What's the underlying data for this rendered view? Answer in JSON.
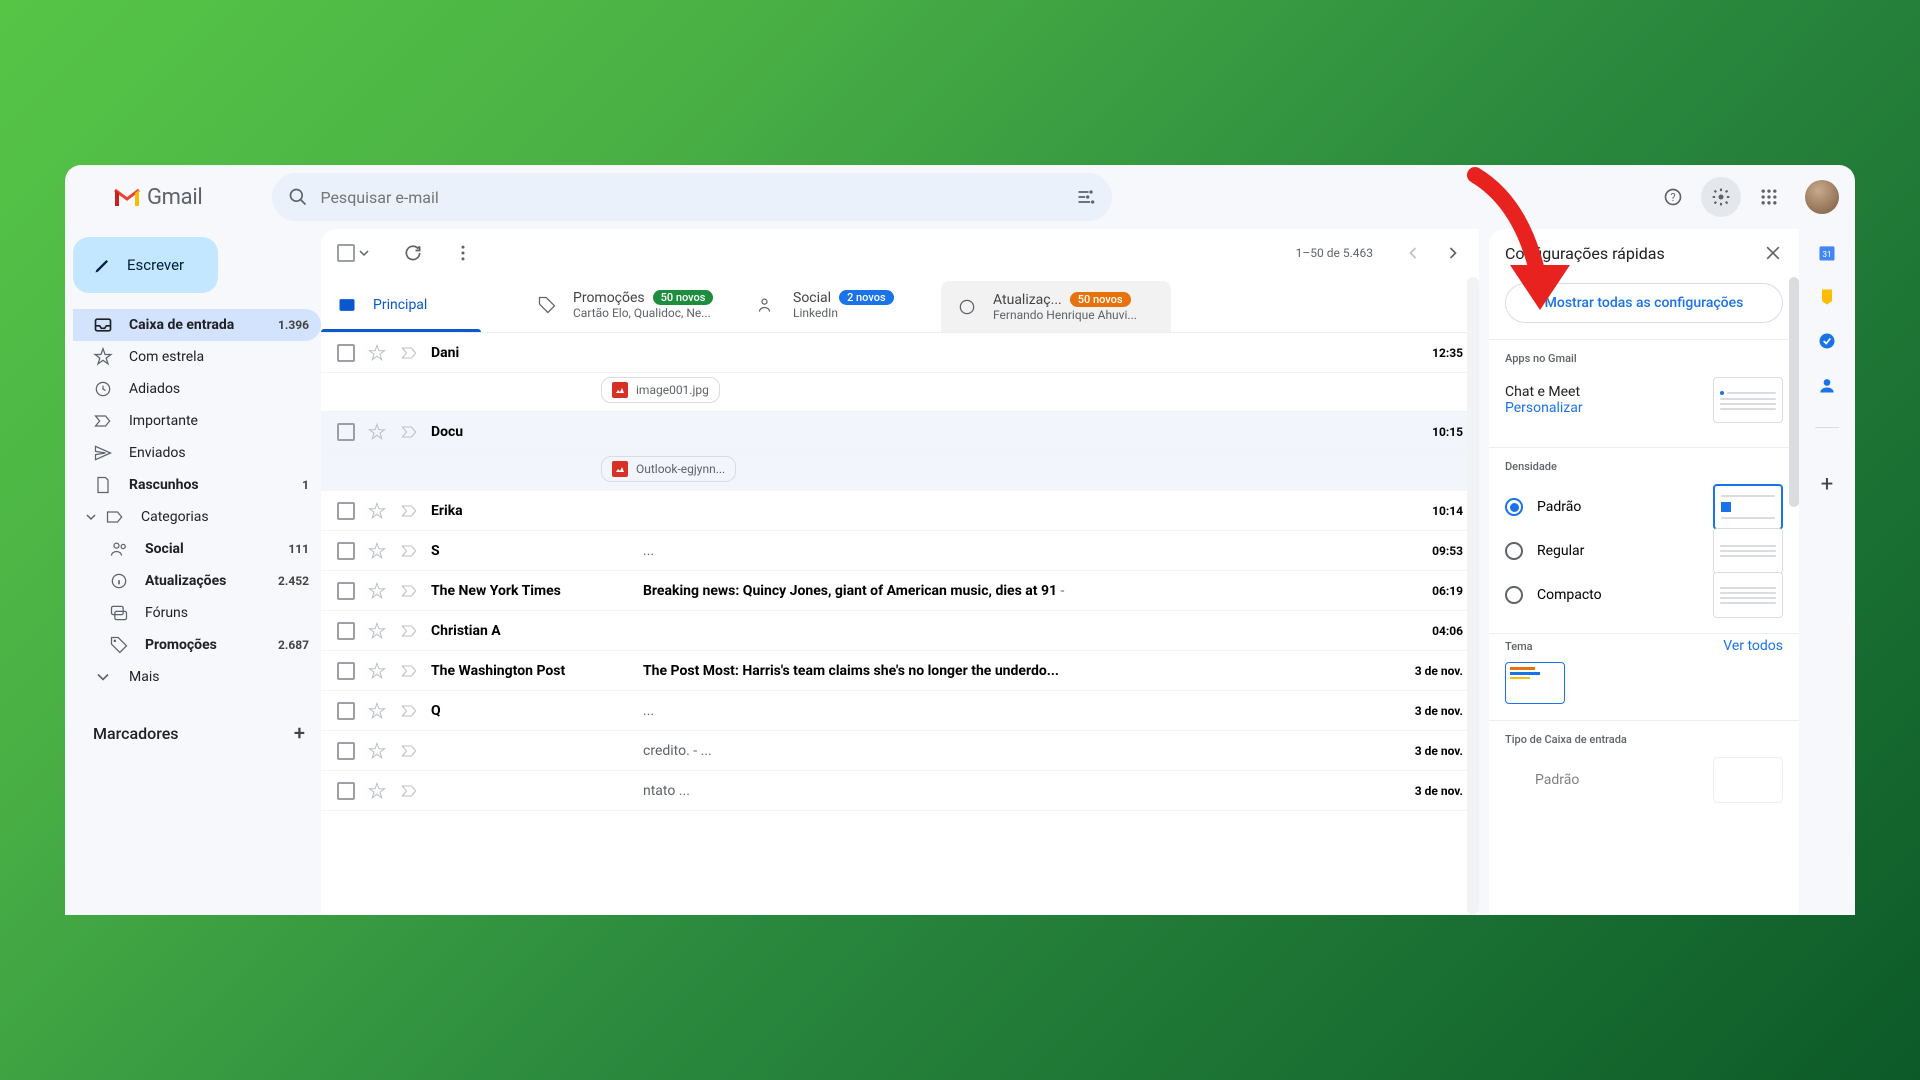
{
  "app": {
    "name": "Gmail"
  },
  "search": {
    "placeholder": "Pesquisar e-mail"
  },
  "compose": {
    "label": "Escrever"
  },
  "nav": {
    "inbox": {
      "label": "Caixa de entrada",
      "count": "1.396"
    },
    "starred": {
      "label": "Com estrela"
    },
    "snoozed": {
      "label": "Adiados"
    },
    "important": {
      "label": "Importante"
    },
    "sent": {
      "label": "Enviados"
    },
    "drafts": {
      "label": "Rascunhos",
      "count": "1"
    },
    "categories": {
      "label": "Categorias"
    },
    "social": {
      "label": "Social",
      "count": "111"
    },
    "updates": {
      "label": "Atualizações",
      "count": "2.452"
    },
    "forums": {
      "label": "Fóruns"
    },
    "promotions": {
      "label": "Promoções",
      "count": "2.687"
    },
    "more": {
      "label": "Mais"
    },
    "labels_header": "Marcadores"
  },
  "toolbar": {
    "page_info": "1–50 de 5.463"
  },
  "tabs": {
    "primary": {
      "label": "Principal"
    },
    "promotions": {
      "label": "Promoções",
      "badge": "50 novos",
      "sub": "Cartão Elo, Qualidoc, Ne..."
    },
    "social": {
      "label": "Social",
      "badge": "2 novos",
      "sub": "LinkedIn"
    },
    "updates": {
      "label": "Atualizaç...",
      "badge": "50 novos",
      "sub": "Fernando Henrique Ahuvi..."
    }
  },
  "mails": [
    {
      "sender": "Dani",
      "subject": "",
      "snippet": "",
      "time": "12:35",
      "attachment": "image001.jpg"
    },
    {
      "sender": "Docu",
      "subject": "",
      "snippet": "",
      "time": "10:15",
      "attachment": "Outlook-egjynn..."
    },
    {
      "sender": "Erika",
      "subject": "",
      "snippet": "",
      "time": "10:14"
    },
    {
      "sender": "S",
      "subject": "",
      "snippet": "...",
      "time": "09:53"
    },
    {
      "sender": "The New York Times",
      "subject": "Breaking news: Quincy Jones, giant of American music, dies at 91",
      "snippet": " - ",
      "time": "06:19"
    },
    {
      "sender": "Christian A",
      "subject": "",
      "snippet": "",
      "time": "04:06"
    },
    {
      "sender": "The Washington Post",
      "subject": "The Post Most: Harris's team claims she's no longer the underdo...",
      "snippet": "",
      "time": "3 de nov."
    },
    {
      "sender": "Q",
      "subject": "",
      "snippet": "...",
      "time": "3 de nov."
    },
    {
      "sender": "",
      "subject": "",
      "snippet": "credito. - ...",
      "time": "3 de nov."
    },
    {
      "sender": "",
      "subject": "",
      "snippet": "ntato ...",
      "time": "3 de nov."
    }
  ],
  "settings": {
    "title": "Configurações rápidas",
    "show_all": "Mostrar todas as configurações",
    "apps_title": "Apps no Gmail",
    "chat_meet": "Chat e Meet",
    "customize": "Personalizar",
    "density_title": "Densidade",
    "density": {
      "default": "Padrão",
      "comfortable": "Regular",
      "compact": "Compacto"
    },
    "theme_title": "Tema",
    "view_all": "Ver todos",
    "inbox_type_title": "Tipo de Caixa de entrada",
    "inbox_type_default": "Padrão"
  }
}
